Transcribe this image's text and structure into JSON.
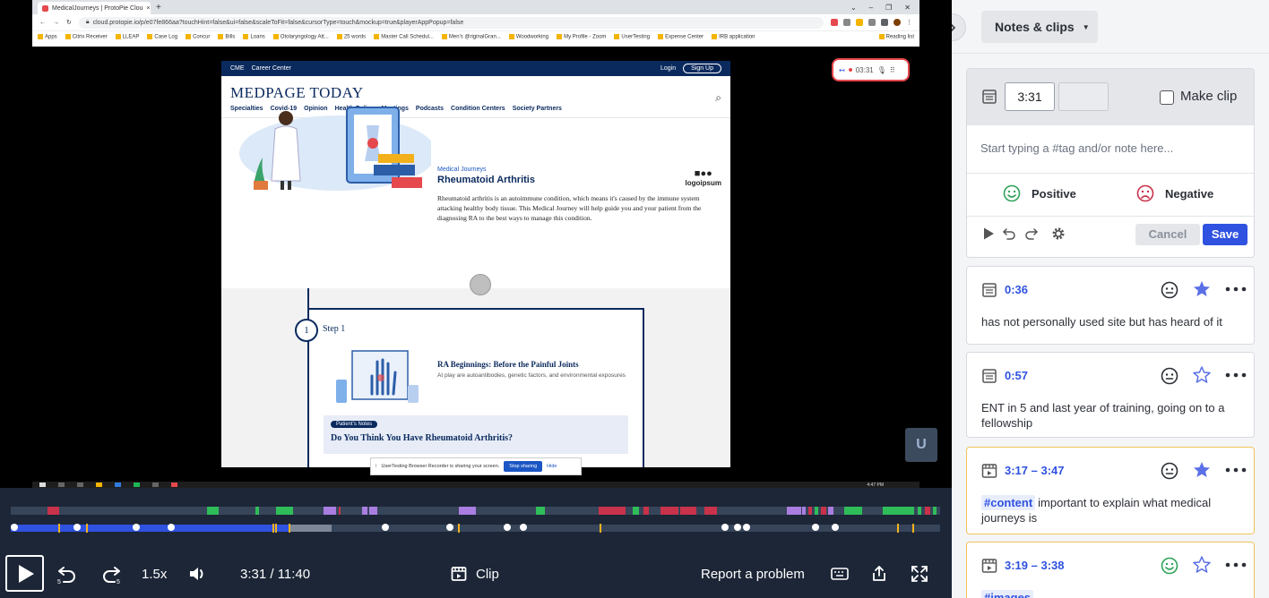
{
  "browser": {
    "tab_title": "MedicalJourneys | ProtoPie Clou",
    "tab_close": "×",
    "new_tab": "+",
    "window_controls": [
      "⌄",
      "–",
      "❐",
      "✕"
    ],
    "url": "cloud.protopie.io/p/e07fe866aa?touchHint=false&ui=false&scaleToFit=false&cursorType=touch&mockup=true&playerAppPopup=false",
    "bookmarks": [
      "Apps",
      "Citrix Receiver",
      "LLEAP",
      "Case Log",
      "Concur",
      "Bills",
      "Loans",
      "Otolaryngology Att...",
      "25 words",
      "Master Call Schedul...",
      "Men's @riginalGran...",
      "Woodworking",
      "My Profile - Zoom",
      "UserTesting",
      "Expense Center",
      "IRB application",
      "Reading list"
    ]
  },
  "webpage": {
    "top_links": [
      "CME",
      "Career Center"
    ],
    "login": "Login",
    "signup": "Sign Up",
    "logo": "MEDPAGE TODAY",
    "nav": [
      "Specialties",
      "Covid-19",
      "Opinion",
      "Health Policy",
      "Meetings",
      "Podcasts",
      "Condition Centers",
      "Society Partners"
    ],
    "journey_label": "Medical Journeys",
    "journey_title": "Rheumatoid Arthritis",
    "journey_desc": "Rheumatoid arthritis is an autoimmune condition, which means it's caused by the immune system attacking healthy body tissue. This Medical Journey will help guide you and your patient from the diagnosing RA to the best ways to manage this condition.",
    "sponsor_logo": "logoipsum",
    "step_number": "1",
    "step_label": "Step 1",
    "step_title": "RA Beginnings: Before the Painful Joints",
    "step_sub": "At play are autoantibodies, genetic factors, and environmental exposures",
    "notes_pill": "Patient's Notes",
    "notes_question": "Do You Think You Have Rheumatoid Arthritis?",
    "share_text": "UserTesting Browser Recorder is sharing your screen.",
    "stop_sharing": "Stop sharing",
    "hide": "Hide",
    "recorder_time": "03:31",
    "taskbar_time": "4:47 PM"
  },
  "player": {
    "play_state": "paused",
    "current_time": "3:31",
    "total_time": "11:40",
    "time_display": "3:31 / 11:40",
    "speed": "1.5x",
    "clip_label": "Clip",
    "report_label": "Report a problem",
    "progress_fraction": 0.3,
    "buffer_fraction": 0.345,
    "colors": {
      "positive": "#2fbd5a",
      "negative": "#c8324a",
      "neutral": "#a97ee0",
      "progress": "#2f52e0",
      "marker": "#f2b11b"
    }
  },
  "panel": {
    "dropdown_label": "Notes & clips",
    "compose": {
      "start_time": "3:31",
      "end_time": "",
      "make_clip": "Make clip",
      "placeholder": "Start typing a #tag and/or note here...",
      "positive": "Positive",
      "negative": "Negative",
      "cancel": "Cancel",
      "save": "Save"
    },
    "notes": [
      {
        "time": "0:36",
        "text": "has not personally used site but has heard of it",
        "tag": "",
        "starred": true,
        "sentiment": "neutral",
        "clip": false
      },
      {
        "time": "0:57",
        "text": "ENT in 5 and last year of training, going on to a fellowship",
        "tag": "",
        "starred": false,
        "sentiment": "neutral",
        "clip": false
      },
      {
        "time": "3:17 – 3:47",
        "text": "important to explain what medical journeys is",
        "tag": "#content",
        "starred": true,
        "sentiment": "neutral",
        "clip": true
      },
      {
        "time": "3:19 – 3:38",
        "text": "",
        "tag": "#images",
        "starred": false,
        "sentiment": "positive",
        "clip": true
      }
    ]
  }
}
